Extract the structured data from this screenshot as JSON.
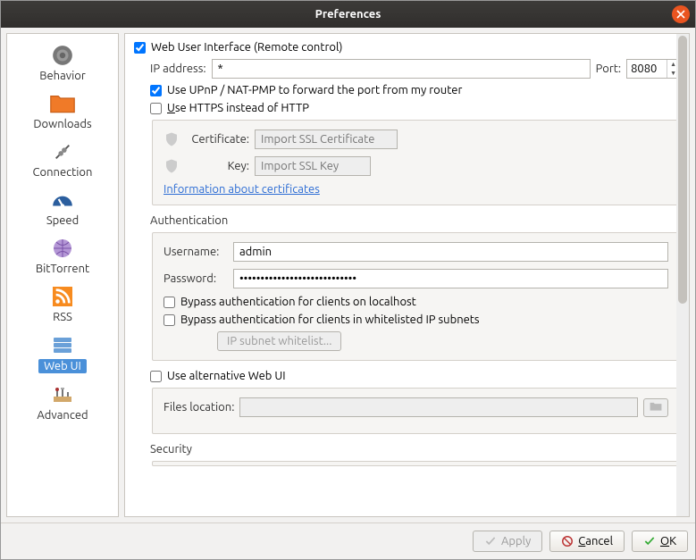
{
  "window": {
    "title": "Preferences"
  },
  "sidebar": {
    "items": [
      {
        "label": "Behavior",
        "icon": "gear-icon"
      },
      {
        "label": "Downloads",
        "icon": "folder-icon"
      },
      {
        "label": "Connection",
        "icon": "plug-icon"
      },
      {
        "label": "Speed",
        "icon": "gauge-icon"
      },
      {
        "label": "BitTorrent",
        "icon": "globe-icon"
      },
      {
        "label": "RSS",
        "icon": "rss-icon"
      },
      {
        "label": "Web UI",
        "icon": "server-icon"
      },
      {
        "label": "Advanced",
        "icon": "tools-icon"
      }
    ],
    "selected": 6
  },
  "webui": {
    "enable_label": "Web User Interface (Remote control)",
    "enable_checked": true,
    "ip_label": "IP address:",
    "ip_value": "*",
    "port_label": "Port:",
    "port_value": "8080",
    "upnp_label": "Use UPnP / NAT-PMP to forward the port from my router",
    "upnp_checked": true,
    "https_label": "Use HTTPS instead of HTTP",
    "https_checked": false,
    "cert_label": "Certificate:",
    "cert_placeholder": "Import SSL Certificate",
    "key_label": "Key:",
    "key_placeholder": "Import SSL Key",
    "cert_info_link": "Information about certificates",
    "auth_title": "Authentication",
    "username_label": "Username:",
    "username_value": "admin",
    "password_label": "Password:",
    "password_value": "••••••••••••••••••••••••••••",
    "bypass_local_label": "Bypass authentication for clients on localhost",
    "bypass_local_checked": false,
    "bypass_whitelist_label": "Bypass authentication for clients in whitelisted IP subnets",
    "bypass_whitelist_checked": false,
    "subnet_button": "IP subnet whitelist...",
    "alt_ui_label": "Use alternative Web UI",
    "alt_ui_checked": false,
    "files_loc_label": "Files location:",
    "security_title": "Security"
  },
  "footer": {
    "apply": "Apply",
    "cancel": "Cancel",
    "ok": "OK"
  }
}
